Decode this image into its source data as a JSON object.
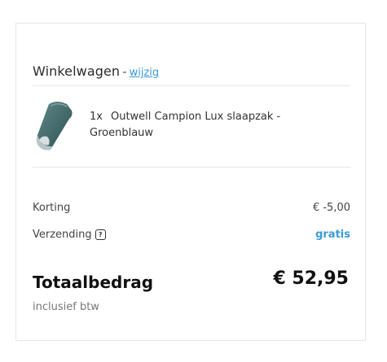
{
  "cart": {
    "title": "Winkelwagen",
    "separator": "-",
    "edit_link": "wijzig"
  },
  "product": {
    "quantity": "1x",
    "name": "Outwell Campion Lux slaapzak - Groenblauw",
    "image_icon": "sleeping-bag-image"
  },
  "summary": {
    "discount_label": "Korting",
    "discount_value": "€ -5,00",
    "shipping_label": "Verzending",
    "shipping_help_icon": "question-mark-icon",
    "shipping_value": "gratis",
    "total_label": "Totaalbedrag",
    "total_value": "€ 52,95",
    "vat_note": "inclusief btw"
  },
  "colors": {
    "link": "#3a9ad9",
    "text": "#222222",
    "muted": "#777777",
    "border": "#e6e6e6"
  }
}
